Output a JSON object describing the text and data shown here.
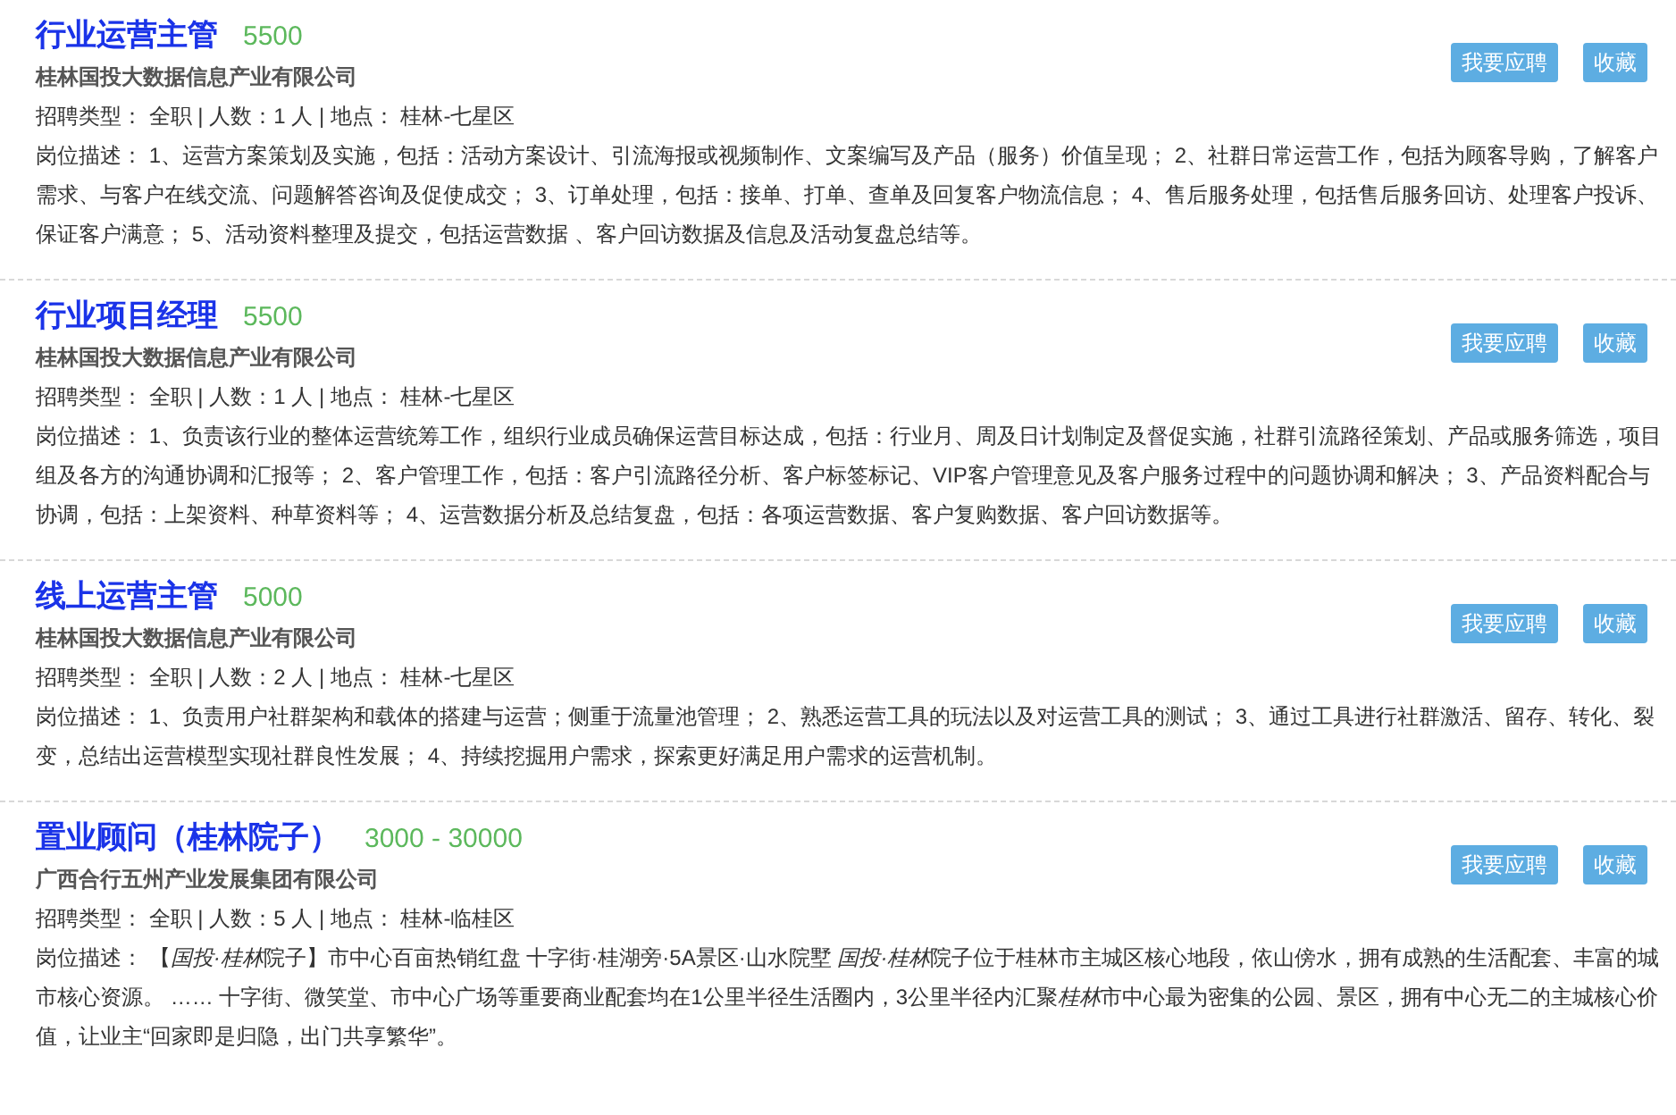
{
  "jobs": [
    {
      "title": "行业运营主管",
      "salary": "5500",
      "company": "桂林国投大数据信息产业有限公司",
      "meta": "招聘类型： 全职 | 人数：1 人 | 地点： 桂林-七星区",
      "description": [
        {
          "text": "岗位描述： 1、运营方案策划及实施，包括：活动方案设计、引流海报或视频制作、文案编写及产品（服务）价值呈现； 2、社群日常运营工作，包括为顾客导购，了解客户需求、与客户在线交流、问题解答咨询及促使成交； 3、订单处理，包括：接单、打单、查单及回复客户物流信息； 4、售后服务处理，包括售后服务回访、处理客户投诉、保证客户满意； 5、活动资料整理及提交，包括运营数据 、客户回访数据及信息及活动复盘总结等。",
          "italic": false
        }
      ],
      "buttons": [
        "我要应聘",
        "收藏"
      ]
    },
    {
      "title": "行业项目经理",
      "salary": "5500",
      "company": "桂林国投大数据信息产业有限公司",
      "meta": "招聘类型： 全职 | 人数：1 人 | 地点： 桂林-七星区",
      "description": [
        {
          "text": "岗位描述： 1、负责该行业的整体运营统筹工作，组织行业成员确保运营目标达成，包括：行业月、周及日计划制定及督促实施，社群引流路径策划、产品或服务筛选，项目组及各方的沟通协调和汇报等； 2、客户管理工作，包括：客户引流路径分析、客户标签标记、VIP客户管理意见及客户服务过程中的问题协调和解决； 3、产品资料配合与协调，包括：上架资料、种草资料等； 4、运营数据分析及总结复盘，包括：各项运营数据、客户复购数据、客户回访数据等。",
          "italic": false
        }
      ],
      "buttons": [
        "我要应聘",
        "收藏"
      ]
    },
    {
      "title": "线上运营主管",
      "salary": "5000",
      "company": "桂林国投大数据信息产业有限公司",
      "meta": "招聘类型： 全职 | 人数：2 人 | 地点： 桂林-七星区",
      "description": [
        {
          "text": "岗位描述： 1、负责用户社群架构和载体的搭建与运营；侧重于流量池管理； 2、熟悉运营工具的玩法以及对运营工具的测试； 3、通过工具进行社群激活、留存、转化、裂变，总结出运营模型实现社群良性发展； 4、持续挖掘用户需求，探索更好满足用户需求的运营机制。",
          "italic": false
        }
      ],
      "buttons": [
        "我要应聘",
        "收藏"
      ]
    },
    {
      "title": "置业顾问（桂林院子）",
      "salary": "3000 - 30000",
      "company": "广西合行五州产业发展集团有限公司",
      "meta": "招聘类型： 全职 | 人数：5 人 | 地点： 桂林-临桂区",
      "description": [
        {
          "text": "岗位描述： 【",
          "italic": false
        },
        {
          "text": "国投·桂林",
          "italic": true
        },
        {
          "text": "院子】市中心百亩热销红盘 十字街·桂湖旁·5A景区·山水院墅 ",
          "italic": false
        },
        {
          "text": "国投·桂林",
          "italic": true
        },
        {
          "text": "院子位于桂林市主城区核心地段，依山傍水，拥有成熟的生活配套、丰富的城市核心资源。 …… 十字街、微笑堂、市中心广场等重要商业配套均在1公里半径生活圈内，3公里半径内汇聚",
          "italic": false
        },
        {
          "text": "桂林",
          "italic": true
        },
        {
          "text": "市中心最为密集的公园、景区，拥有中心无二的主城核心价值，让业主“回家即是归隐，出门共享繁华”。",
          "italic": false
        }
      ],
      "buttons": [
        "我要应聘",
        "收藏"
      ]
    }
  ]
}
